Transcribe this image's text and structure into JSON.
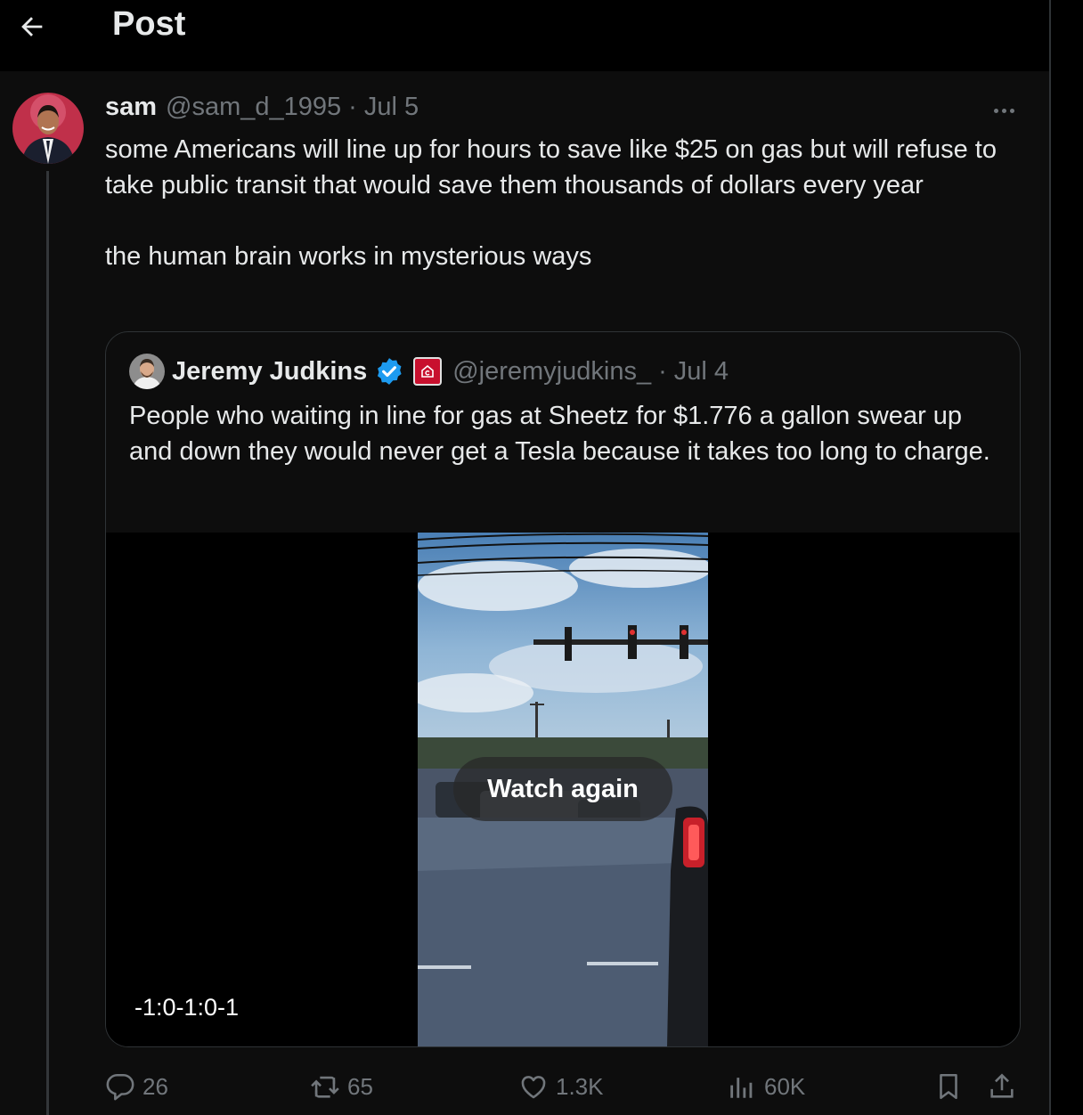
{
  "header": {
    "title": "Post",
    "back_icon": "arrow-left-icon"
  },
  "post": {
    "author": {
      "name": "sam",
      "handle": "@sam_d_1995",
      "separator": "·",
      "date": "Jul 5"
    },
    "text": "some Americans will line up for hours to save like $25 on gas but will refuse to take public transit that would save them thousands of dollars every year\n\nthe human brain works in mysterious ways",
    "quote": {
      "author": {
        "name": "Jeremy Judkins",
        "handle": "@jeremyjudkins_",
        "separator": "·",
        "date": "Jul 4",
        "verified": true
      },
      "text": "People who waiting in line for gas at Sheetz for $1.776 a gallon swear up and down they would never get a Tesla because it takes too long to charge.",
      "video": {
        "overlay_label": "Watch again",
        "timecode": "-1:0-1:0-1"
      }
    },
    "actions": {
      "replies": "26",
      "reposts": "65",
      "likes": "1.3K",
      "views": "60K"
    }
  },
  "colors": {
    "background": "#000000",
    "text": "#e7e9ea",
    "muted": "#71767b",
    "verified": "#1d9bf0",
    "border": "#2f3336"
  }
}
